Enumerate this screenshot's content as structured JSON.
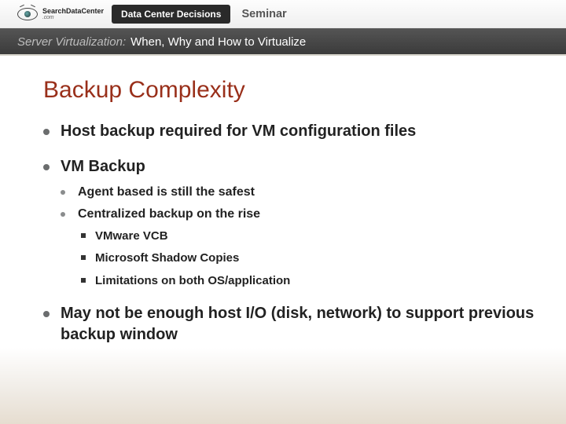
{
  "topbar": {
    "brand_line1": "SearchDataCenter",
    "brand_line2": ".com",
    "pill": "Data Center Decisions",
    "seminar": "Seminar"
  },
  "subbar": {
    "italic": "Server Virtualization:",
    "rest": "When, Why and How to Virtualize"
  },
  "title": "Backup Complexity",
  "bullets": {
    "b1": "Host backup required for VM configuration files",
    "b2": "VM Backup",
    "b2_sub": {
      "s1": "Agent based is still the safest",
      "s2": "Centralized backup on the rise",
      "s2_sub": {
        "t1": "VMware VCB",
        "t2": "Microsoft Shadow Copies",
        "t3": "Limitations on both OS/application"
      }
    },
    "b3": "May not be enough host I/O (disk, network) to support previous backup window"
  }
}
